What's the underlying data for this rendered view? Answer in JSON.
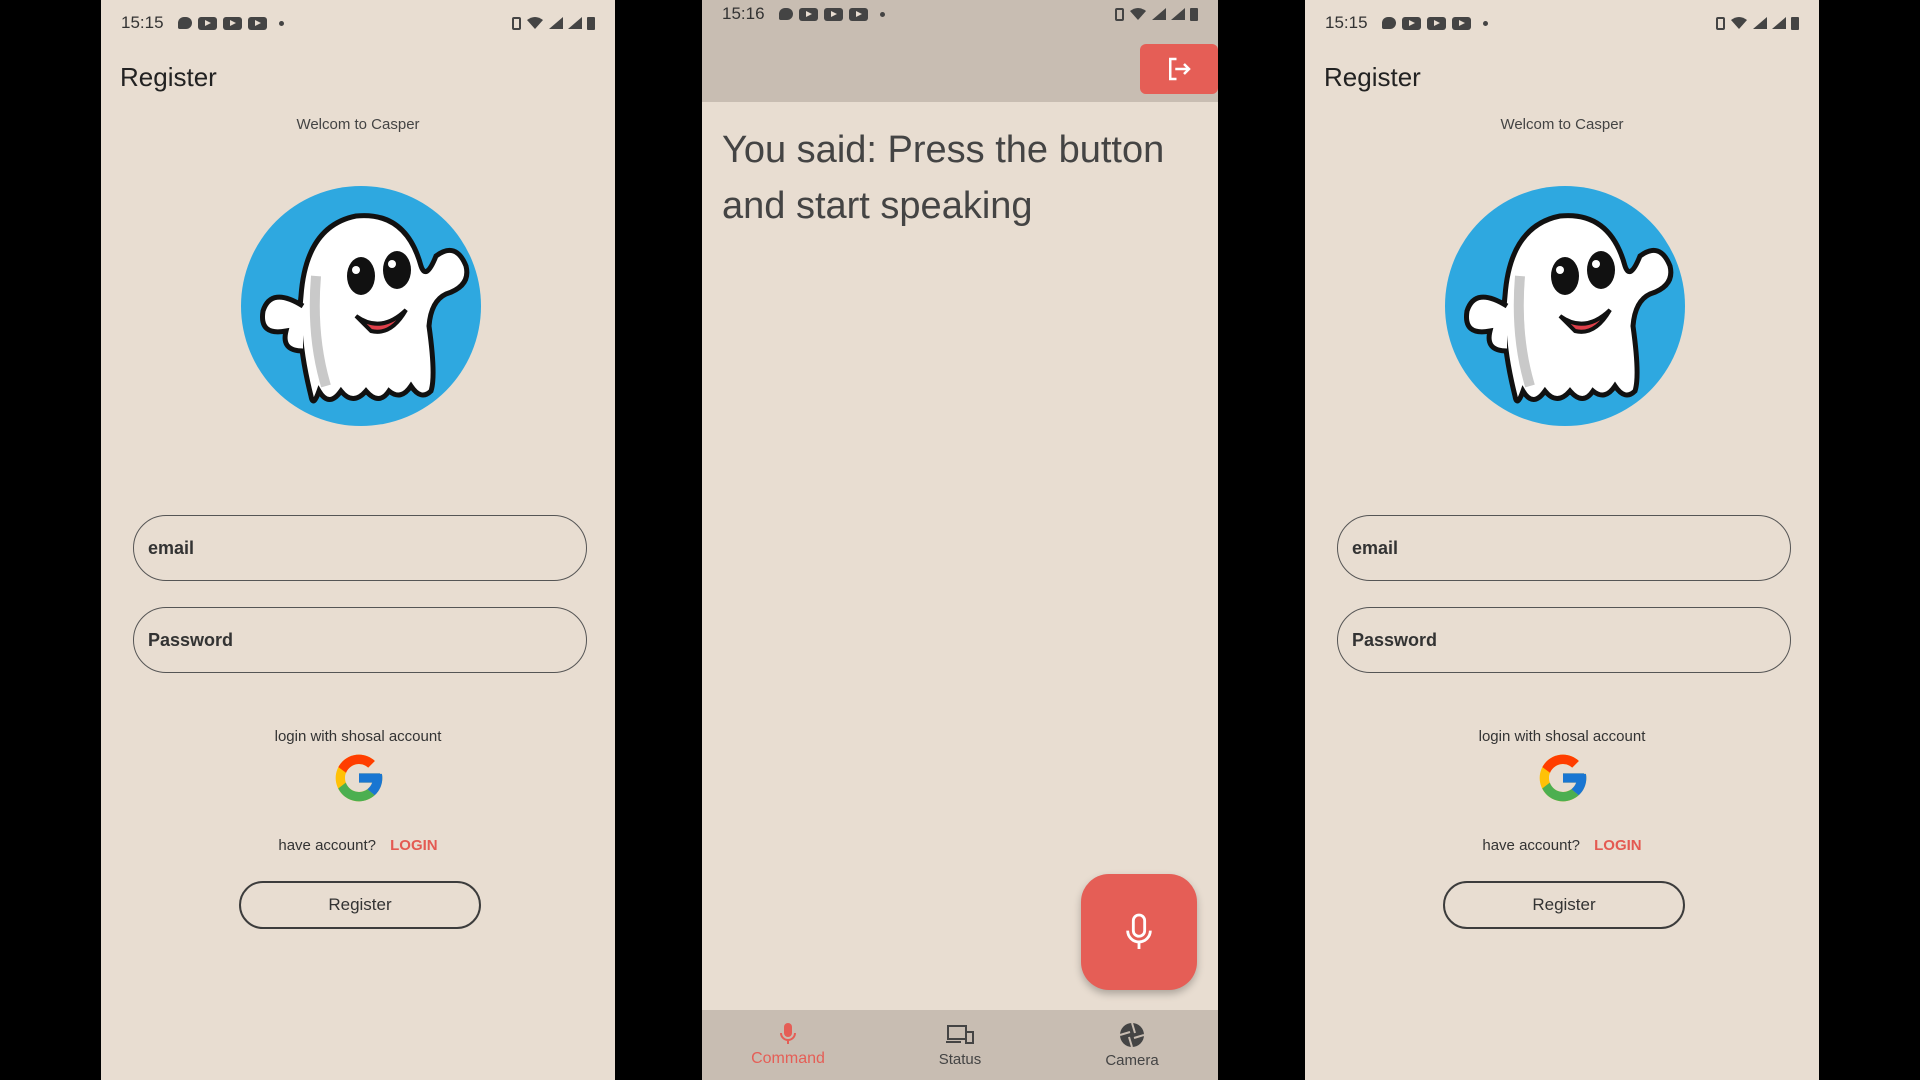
{
  "left_screen": {
    "statusbar": {
      "time": "15:15"
    },
    "title": "Register",
    "subtitle": "Welcom to Casper",
    "email_placeholder": "email",
    "password_placeholder": "Password",
    "social_text": "login with shosal account",
    "have_account": "have account?",
    "login_link": "LOGIN",
    "register_button": "Register"
  },
  "middle_screen": {
    "statusbar": {
      "time": "15:16"
    },
    "speech_text": "You said: Press the button and start speaking",
    "nav": [
      {
        "label": "Command",
        "icon": "mic-icon",
        "active": true
      },
      {
        "label": "Status",
        "icon": "devices-icon",
        "active": false
      },
      {
        "label": "Camera",
        "icon": "camera-shutter-icon",
        "active": false
      }
    ]
  },
  "right_screen": {
    "statusbar": {
      "time": "15:15"
    },
    "title": "Register",
    "subtitle": "Welcom to Casper",
    "email_placeholder": "email",
    "password_placeholder": "Password",
    "social_text": "login with shosal account",
    "have_account": "have account?",
    "login_link": "LOGIN",
    "register_button": "Register"
  },
  "colors": {
    "background": "#e8ddd1",
    "accent": "#e55e56",
    "bar": "#c8bdb2"
  }
}
